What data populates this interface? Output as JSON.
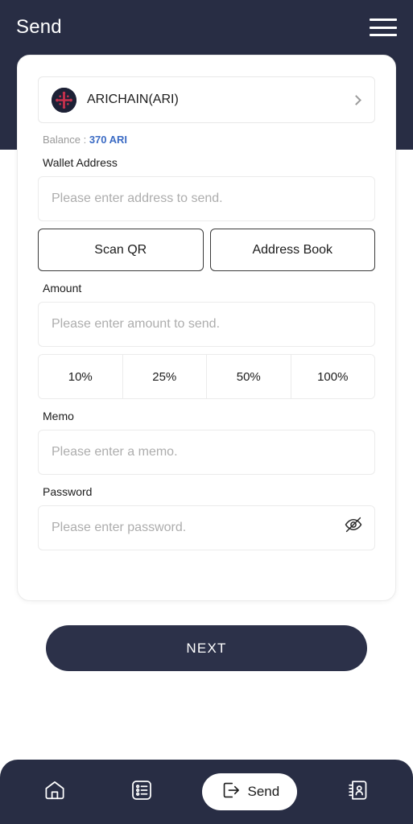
{
  "header": {
    "title": "Send",
    "menu_icon": "hamburger-menu-icon"
  },
  "token_selector": {
    "logo_icon": "arichain-token-logo",
    "name": "ARICHAIN(ARI)",
    "chevron_icon": "chevron-right-icon"
  },
  "balance": {
    "label": "Balance : ",
    "value": "370 ARI",
    "value_color": "#3B6BC4"
  },
  "wallet_address": {
    "label": "Wallet Address",
    "input_value": "",
    "placeholder": "Please enter address to send.",
    "scan_qr_label": "Scan QR",
    "address_book_label": "Address Book"
  },
  "amount": {
    "label": "Amount",
    "input_value": "",
    "placeholder": "Please enter amount to send.",
    "percent_options": [
      "10%",
      "25%",
      "50%",
      "100%"
    ]
  },
  "memo": {
    "label": "Memo",
    "input_value": "",
    "placeholder": "Please enter a memo."
  },
  "password": {
    "label": "Password",
    "input_value": "",
    "placeholder": "Please enter password.",
    "toggle_icon": "eye-off-icon"
  },
  "next_button": {
    "label": "NEXT"
  },
  "bottom_nav": {
    "items": [
      {
        "icon": "home-icon",
        "label": ""
      },
      {
        "icon": "list-icon",
        "label": ""
      },
      {
        "icon": "send-arrow-icon",
        "label": "Send"
      },
      {
        "icon": "address-book-icon",
        "label": ""
      }
    ]
  },
  "colors": {
    "header_bg": "#282D44",
    "accent": "#3B6BC4",
    "token_logo_bg": "#1D2136",
    "token_logo_mark": "#C8314D"
  }
}
